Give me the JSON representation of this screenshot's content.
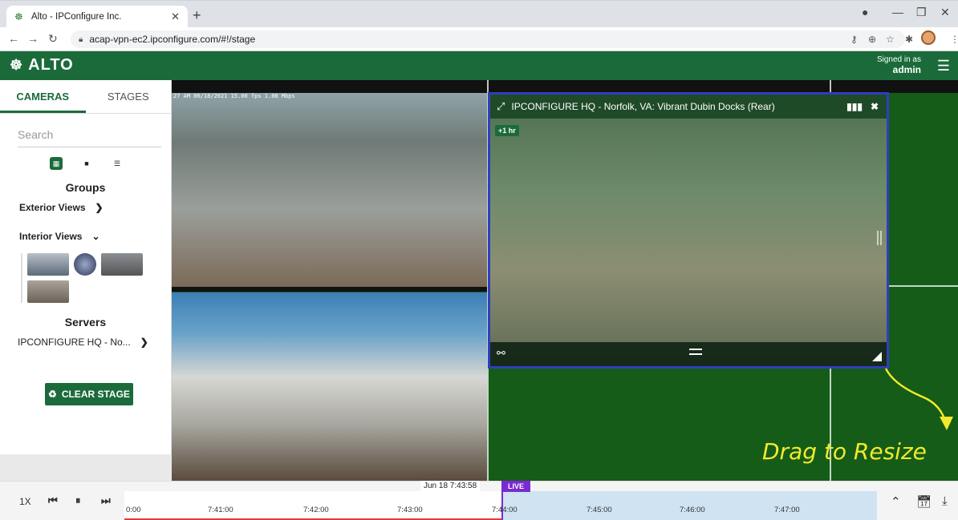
{
  "browser": {
    "tab_title": "Alto - IPConfigure Inc.",
    "new_tab": "+",
    "url": "acap-vpn-ec2.ipconfigure.com/#!/stage"
  },
  "app": {
    "logo": "ALTO",
    "signed_in_label": "Signed in as",
    "user": "admin"
  },
  "sidebar": {
    "tabs": [
      {
        "label": "CAMERAS",
        "active": true
      },
      {
        "label": "STAGES",
        "active": false
      }
    ],
    "search_placeholder": "Search",
    "groups_heading": "Groups",
    "groups": [
      {
        "label": "Exterior Views",
        "expanded": false
      },
      {
        "label": "Interior Views",
        "expanded": true
      }
    ],
    "servers_heading": "Servers",
    "servers": [
      {
        "label": "IPCONFIGURE HQ - No..."
      }
    ],
    "clear_stage": "CLEAR STAGE"
  },
  "stage": {
    "cam1_osd": "27 AM 06/18/2021 15.00 fps 1.08 Mbps",
    "selected_camera": {
      "title": "IPCONFIGURE HQ - Norfolk, VA: Vibrant Dubin Docks (Rear)",
      "badge": "+1 hr"
    },
    "annotation": "Drag to Resize"
  },
  "timeline": {
    "speed": "1X",
    "current_time": "Jun 18 7:43:58",
    "live": "LIVE",
    "ticks": [
      "0:00",
      "7:41:00",
      "7:42:00",
      "7:43:00",
      "7:44:00",
      "7:45:00",
      "7:46:00",
      "7:47:00"
    ]
  },
  "colors": {
    "brand_green": "#1b6b3a",
    "selection_border": "#2f3fbf",
    "annotation_yellow": "#f2ea2c",
    "live_purple": "#7b2bd1",
    "playback_red": "#e23b3b"
  }
}
